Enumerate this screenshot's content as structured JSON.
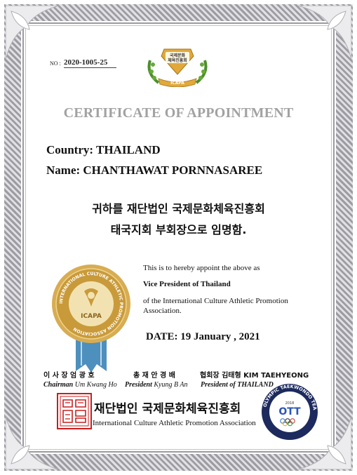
{
  "certificate": {
    "no_label": "NO :",
    "no_value": "2020-1005-25",
    "emblem_text_top": "국제문화",
    "emblem_text_bottom": "체육진흥회",
    "emblem_ribbon": "ICAPA",
    "title": "CERTIFICATE OF APPOINTMENT",
    "country": "Country: THAILAND",
    "name": "Name: CHANTHAWAT PORNNASAREE",
    "korean_line1": "귀하를 재단법인 국제문화체육진흥회",
    "korean_line2": "태국지회 부회장으로 임명함.",
    "appoint_line1": "This is to hereby appoint the above as",
    "appoint_line2": "Vice  President of  Thailand",
    "appoint_line3": "of the International Culture Athletic Promotion Association.",
    "date": "DATE: 19  January , 2021"
  },
  "seal": {
    "ring_text": "INTERNATIONAL CULTURE ATHLETIC PROMOTION ASSOCIATION",
    "center_label": "ICAPA"
  },
  "signatures": {
    "sig1": "이 사 장  엄 광 호",
    "sig2": "총  재  안 경 배",
    "sig3": "협회장 김태형 KIM TAEHYEONG",
    "label1_title": "Chairman",
    "label1_name": "Um Kwang Ho",
    "label2_title": "President",
    "label2_name": "Kyung B An",
    "label3_title": "President of THAILAND"
  },
  "footer": {
    "org_korean": "재단법인 국제문화체육진흥회",
    "org_english": "International Culture Athletic Promotion Association",
    "right_logo_ring": "OLYMPIC TAEKWONDO TEAM",
    "right_logo_center": "OTT",
    "right_logo_year": "2018"
  },
  "colors": {
    "title_gray": "#a2a2a2",
    "seal_gold": "#c99a3a",
    "ribbon_blue": "#4d8fbd",
    "stamp_red": "#c81e1e",
    "emblem_green": "#4c8f2a"
  }
}
